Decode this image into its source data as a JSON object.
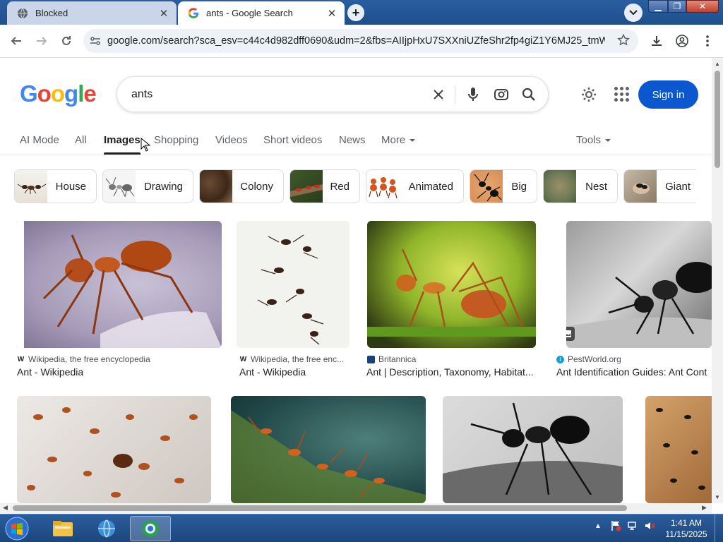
{
  "browser": {
    "tabs": [
      {
        "title": "Blocked",
        "active": false
      },
      {
        "title": "ants - Google Search",
        "active": true
      }
    ],
    "url": "google.com/search?sca_esv=c44c4d982dff0690&udm=2&fbs=AIIjpHxU7SXXniUZfeShr2fp4giZ1Y6MJ25_tmWITc..."
  },
  "google": {
    "logo": "Google",
    "query": "ants",
    "sign_in": "Sign in",
    "nav": [
      "AI Mode",
      "All",
      "Images",
      "Shopping",
      "Videos",
      "Short videos",
      "News",
      "More"
    ],
    "tools": "Tools",
    "selected_nav": "Images"
  },
  "chips": [
    "House",
    "Drawing",
    "Colony",
    "Red",
    "Animated",
    "Big",
    "Nest",
    "Giant"
  ],
  "results": [
    {
      "source": "Wikipedia, the free encyclopedia",
      "title": "Ant - Wikipedia",
      "icon": "W"
    },
    {
      "source": "Wikipedia, the free enc...",
      "title": "Ant - Wikipedia",
      "icon": "W"
    },
    {
      "source": "Britannica",
      "title": "Ant | Description, Taxonomy, Habitat...",
      "icon": "britannica-icon"
    },
    {
      "source": "PestWorld.org",
      "title": "Ant Identification Guides: Ant Cont",
      "icon": "info-icon"
    }
  ],
  "taskbar": {
    "time": "1:41 AM",
    "date": "11/15/2025"
  },
  "colors": {
    "brand_blue": "#4285F4",
    "brand_red": "#EA4335",
    "brand_yellow": "#FBBC05",
    "brand_green": "#34A853",
    "sign_in_bg": "#0b57d0"
  }
}
